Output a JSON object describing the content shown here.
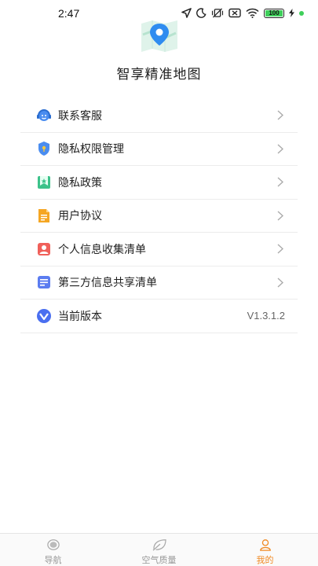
{
  "status_bar": {
    "time": "2:47",
    "battery": "100"
  },
  "header": {
    "app_title": "智享精准地图"
  },
  "menu": {
    "items": [
      {
        "label": "联系客服",
        "icon": "headset-icon"
      },
      {
        "label": "隐私权限管理",
        "icon": "shield-icon"
      },
      {
        "label": "隐私政策",
        "icon": "bookmark-icon"
      },
      {
        "label": "用户协议",
        "icon": "document-icon"
      },
      {
        "label": "个人信息收集清单",
        "icon": "person-card-icon"
      },
      {
        "label": "第三方信息共享清单",
        "icon": "list-icon"
      },
      {
        "label": "当前版本",
        "icon": "version-icon"
      }
    ],
    "version_value": "V1.3.1.2"
  },
  "tab_bar": {
    "tabs": [
      {
        "label": "导航",
        "icon": "navigation-icon",
        "active": false
      },
      {
        "label": "空气质量",
        "icon": "leaf-icon",
        "active": false
      },
      {
        "label": "我的",
        "icon": "user-icon",
        "active": true
      }
    ]
  },
  "colors": {
    "accent": "#f08a24",
    "inactive_tab": "#999999",
    "blue_icon": "#4a8df0",
    "green_icon": "#3cc28a",
    "orange_icon": "#f5a623",
    "red_icon": "#f0605a",
    "indigo_icon": "#5b7cf0"
  }
}
